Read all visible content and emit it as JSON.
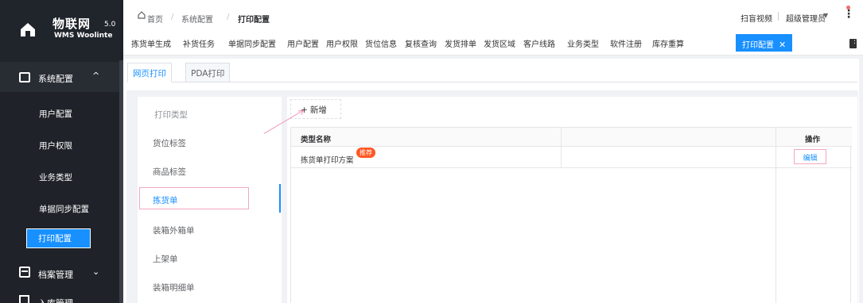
{
  "logo": {
    "title": "物联网",
    "version": "5.0",
    "subtitle": "WMS Woolinte"
  },
  "sidebar": {
    "group": {
      "label": "系统配置",
      "chevron": "^"
    },
    "items": [
      {
        "label": "用户配置"
      },
      {
        "label": "用户权限"
      },
      {
        "label": "业务类型"
      },
      {
        "label": "单据同步配置"
      },
      {
        "label": "打印配置",
        "active": true
      }
    ],
    "group2": {
      "label": "档案管理",
      "chevron": "⌄"
    },
    "group3": {
      "label": "入库管理"
    }
  },
  "header": {
    "breadcrumb": [
      "首页",
      "/",
      "系统配置",
      "/",
      "打印配置"
    ],
    "scan_video": "扫盲视频",
    "user": "超级管理员",
    "colors": {
      "accent": "#1890ff",
      "sidebar": "#1f2329"
    }
  },
  "tags": [
    "拣货单生成",
    "补货任务",
    "单据同步配置",
    "用户配置",
    "用户权限",
    "货位信息",
    "复核查询",
    "发货排单",
    "发货区域",
    "客户线路",
    "业务类型",
    "软件注册",
    "库存重算"
  ],
  "active_tag": {
    "label": "打印配置",
    "close": "✕"
  },
  "page_tabs": {
    "web": "网页打印",
    "pda": "PDA打印"
  },
  "type_list": {
    "header": "打印类型",
    "items": [
      "货位标签",
      "商品标签",
      "拣货单",
      "装箱外箱单",
      "上架单",
      "装箱明细单"
    ],
    "active": "拣货单"
  },
  "toolbar": {
    "add_label": "新增",
    "add_icon": "+"
  },
  "table": {
    "headers": {
      "name": "类型名称",
      "op": "操作"
    },
    "rows": [
      {
        "name": "拣货单打印方案",
        "badge": "推荐",
        "action": "编辑"
      }
    ]
  }
}
